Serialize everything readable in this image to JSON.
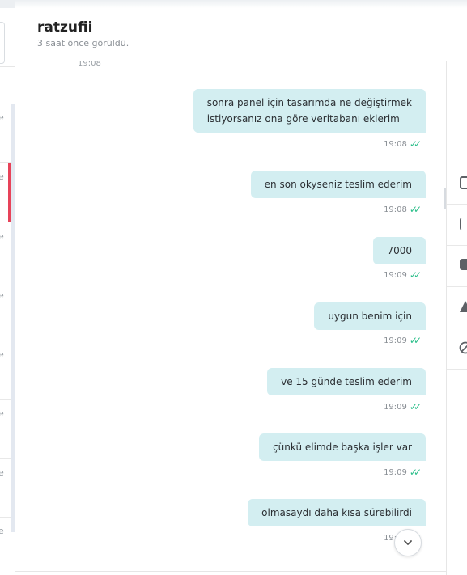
{
  "header": {
    "username": "ratzufii",
    "last_seen": "3 saat önce görüldü."
  },
  "chat": {
    "top_time": "19:08",
    "messages": [
      {
        "lines": [
          "sonra panel için tasarımda ne değiştirmek",
          "istiyorsanız ona göre veritabanı eklerim"
        ],
        "time": "19:08"
      },
      {
        "lines": [
          "en son okyseniz teslim ederim"
        ],
        "time": "19:08"
      },
      {
        "lines": [
          "7000"
        ],
        "time": "19:09"
      },
      {
        "lines": [
          "uygun benim için"
        ],
        "time": "19:09"
      },
      {
        "lines": [
          "ve 15 günde teslim ederim"
        ],
        "time": "19:09"
      },
      {
        "lines": [
          "çünkü elimde başka işler var"
        ],
        "time": "19:09"
      },
      {
        "lines": [
          "olmasaydı daha kısa sürebilirdi"
        ],
        "time": "19:09"
      }
    ]
  },
  "left_list": {
    "item_chars": [
      "e",
      "e",
      "e",
      "e",
      "e",
      "e",
      "e",
      "e"
    ]
  },
  "icons": {
    "read_receipt": "double-check-icon",
    "scroll_down": "chevron-down-icon"
  },
  "colors": {
    "bubble": "#d3eef1",
    "tick": "#2bbf8a",
    "active_marker": "#e74359"
  }
}
